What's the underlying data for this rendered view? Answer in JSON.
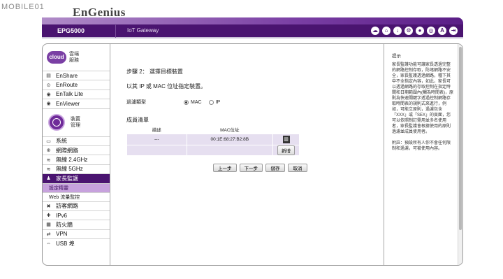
{
  "watermark": "MOBILE01",
  "brand": "EnGenius",
  "header": {
    "model": "EPG5000",
    "product": "IoT Gateway",
    "icons": [
      "cloud-download-icon",
      "home-icon",
      "download-icon",
      "gear-icon",
      "user-icon",
      "globe-icon",
      "account-icon",
      "logout-icon"
    ]
  },
  "sidebar": {
    "cloud_group": {
      "logo": "cloud",
      "label": "雲端服務"
    },
    "cloud_items": [
      {
        "label": "EnShare",
        "icon": "document-icon"
      },
      {
        "label": "EnRoute",
        "icon": "location-icon"
      },
      {
        "label": "EnTalk Lite",
        "icon": "talk-icon"
      },
      {
        "label": "EnViewer",
        "icon": "camera-icon"
      }
    ],
    "device_group": {
      "label": "裝置管理"
    },
    "device_items": [
      {
        "label": "系統",
        "icon": "monitor-icon"
      },
      {
        "label": "網際網路",
        "icon": "globe-icon"
      },
      {
        "label": "無線 2.4GHz",
        "icon": "wifi-icon"
      },
      {
        "label": "無線 5GHz",
        "icon": "wifi-icon"
      }
    ],
    "parental": {
      "label": "家長監護",
      "icon": "family-icon"
    },
    "parental_sub": [
      {
        "label": "設定精靈"
      },
      {
        "label": "Web 流量監控"
      }
    ],
    "more_items": [
      {
        "label": "訪客網路",
        "icon": "tools-icon"
      },
      {
        "label": "IPv6",
        "icon": "ipv6-icon"
      },
      {
        "label": "防火牆",
        "icon": "firewall-icon"
      },
      {
        "label": "VPN",
        "icon": "vpn-icon"
      },
      {
        "label": "USB 埠",
        "icon": "usb-icon"
      }
    ]
  },
  "main": {
    "step_title": "步驟 2： 選擇目標裝置",
    "subtitle": "以其 IP 或 MAC 位址指定裝置。",
    "filter_label": "過濾類型",
    "filter_options": [
      "MAC",
      "IP"
    ],
    "members_title": "成員清單",
    "table_headers": [
      "描述",
      "MAC位址"
    ],
    "rows": [
      {
        "desc": "---",
        "mac": "00:1E:68:27:B2:8B"
      }
    ],
    "add_label": "新增",
    "buttons": {
      "prev": "上一步",
      "next": "下一步",
      "save": "儲存",
      "cancel": "取消"
    }
  },
  "help": {
    "title": "提示",
    "body": "家長監護功能可讓家長透過完整的網路控制存取，防堵網路不安全，家長監護透過網路，種下其中不全指定內容，如此，家長可以透過網路的存取控制在指定時間和日期範圍內(觸為時間表)，原則為快速關鍵字透過控制網路存取時間表的規則式來進行，例如，可能立原則，過濾包含「XXX」或「SEX」的頁面，您可以依照制訂需用並多名使用者，家長監護會根據使用的原則過濾並成員使用者。",
    "note": "附註：預設所有人你不會任何限制和過濾，可被使用內容。"
  }
}
